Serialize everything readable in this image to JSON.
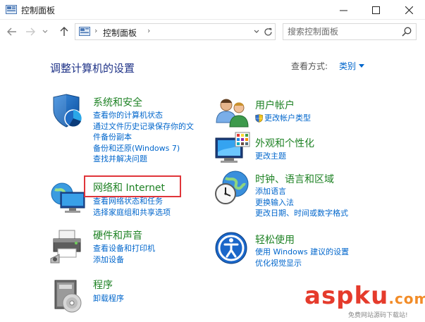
{
  "window": {
    "title": "控制面板"
  },
  "address": {
    "crumb": "控制面板",
    "sep": "›"
  },
  "search": {
    "placeholder": "搜索控制面板"
  },
  "main": {
    "heading": "调整计算机的设置",
    "view_by_label": "查看方式:",
    "view_by_value": "类别"
  },
  "categories": [
    {
      "title": "系统和安全",
      "links": [
        "查看你的计算机状态",
        "通过文件历史记录保存你的文",
        "件备份副本",
        "备份和还原(Windows 7)",
        "查找并解决问题"
      ],
      "icon": "shield-icon"
    },
    {
      "title": "网络和 Internet",
      "links": [
        "查看网络状态和任务",
        "选择家庭组和共享选项"
      ],
      "icon": "network-globe-icon"
    },
    {
      "title": "硬件和声音",
      "links": [
        "查看设备和打印机",
        "添加设备"
      ],
      "icon": "printer-icon"
    },
    {
      "title": "程序",
      "links": [
        "卸载程序"
      ],
      "icon": "programs-icon"
    },
    {
      "title": "用户帐户",
      "links": [
        "更改帐户类型"
      ],
      "icon": "users-icon"
    },
    {
      "title": "外观和个性化",
      "links": [
        "更改主题"
      ],
      "icon": "monitor-palette-icon"
    },
    {
      "title": "时钟、语言和区域",
      "links": [
        "添加语言",
        "更换输入法",
        "更改日期、时间或数字格式"
      ],
      "icon": "clock-globe-icon"
    },
    {
      "title": "轻松使用",
      "links": [
        "使用 Windows 建议的设置",
        "优化视觉显示"
      ],
      "icon": "ease-of-access-icon"
    }
  ],
  "watermark": {
    "brand": "aspku",
    "suffix": ".com",
    "tagline": "免费网站源码下载站!"
  },
  "colors": {
    "category_title": "#1e8224",
    "link": "#0066cc",
    "heading": "#1e3287",
    "highlight": "#e0353a"
  }
}
